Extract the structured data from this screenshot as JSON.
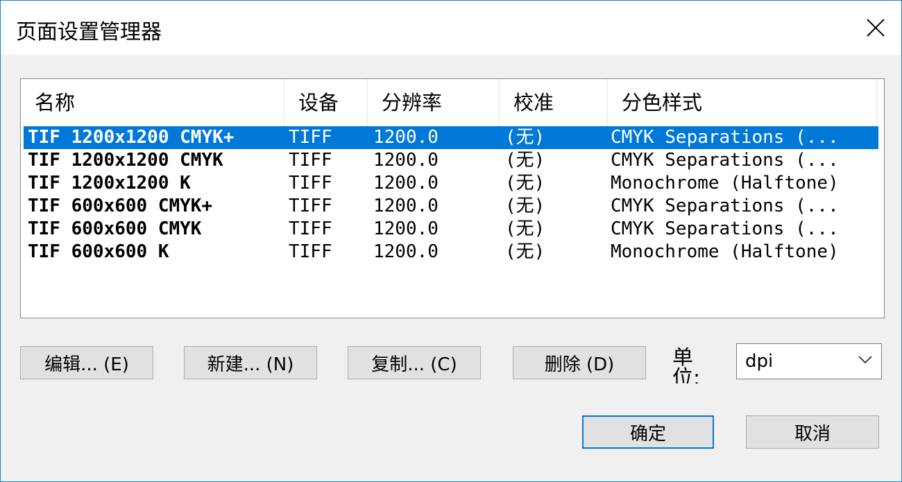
{
  "window": {
    "title": "页面设置管理器"
  },
  "list": {
    "columns": [
      "名称",
      "设备",
      "分辨率",
      "校准",
      "分色样式"
    ],
    "rows": [
      {
        "name": "TIF 1200x1200 CMYK+",
        "device": "TIFF",
        "resolution": "1200.0",
        "calibration": "(无)",
        "separation": "CMYK Separations (...",
        "selected": true
      },
      {
        "name": "TIF 1200x1200 CMYK",
        "device": "TIFF",
        "resolution": "1200.0",
        "calibration": "(无)",
        "separation": "CMYK Separations (...",
        "selected": false
      },
      {
        "name": "TIF 1200x1200 K",
        "device": "TIFF",
        "resolution": "1200.0",
        "calibration": "(无)",
        "separation": "Monochrome (Halftone)",
        "selected": false
      },
      {
        "name": "TIF 600x600 CMYK+",
        "device": "TIFF",
        "resolution": "1200.0",
        "calibration": "(无)",
        "separation": "CMYK Separations (...",
        "selected": false
      },
      {
        "name": "TIF 600x600 CMYK",
        "device": "TIFF",
        "resolution": "1200.0",
        "calibration": "(无)",
        "separation": "CMYK Separations (...",
        "selected": false
      },
      {
        "name": "TIF 600x600 K",
        "device": "TIFF",
        "resolution": "1200.0",
        "calibration": "(无)",
        "separation": "Monochrome (Halftone)",
        "selected": false
      }
    ]
  },
  "actions": {
    "edit": "编辑... (E)",
    "new": "新建... (N)",
    "copy": "复制... (C)",
    "delete": "删除 (D)"
  },
  "unit": {
    "label": "单位:",
    "value": "dpi"
  },
  "footer": {
    "ok": "确定",
    "cancel": "取消"
  },
  "colors": {
    "selection": "#0078d7",
    "window_border": "#1883d7"
  }
}
